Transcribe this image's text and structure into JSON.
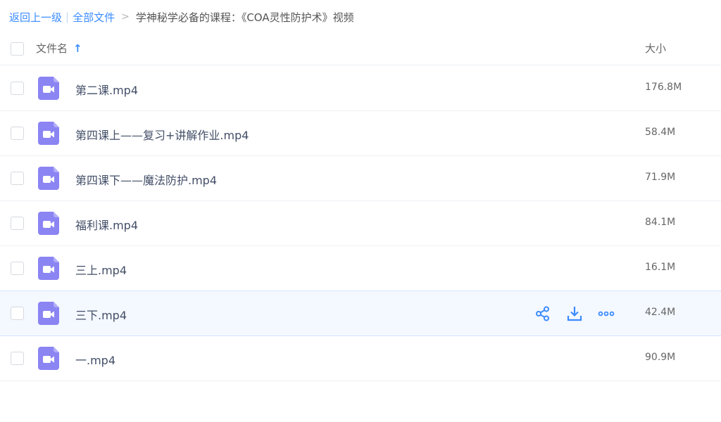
{
  "breadcrumb": {
    "back_label": "返回上一级",
    "divider": "|",
    "all_files_label": "全部文件",
    "separator": ">",
    "current_folder": "学神秘学必备的课程：《COA灵性防护术》视频"
  },
  "list_header": {
    "name_label": "文件名",
    "sort_icon": "arrow-up-icon",
    "size_label": "大小"
  },
  "files": [
    {
      "name": "第二课.mp4",
      "size": "176.8M",
      "icon": "video-file-icon"
    },
    {
      "name": "第四课上——复习+讲解作业.mp4",
      "size": "58.4M",
      "icon": "video-file-icon"
    },
    {
      "name": "第四课下——魔法防护.mp4",
      "size": "71.9M",
      "icon": "video-file-icon"
    },
    {
      "name": "福利课.mp4",
      "size": "84.1M",
      "icon": "video-file-icon"
    },
    {
      "name": "三上.mp4",
      "size": "16.1M",
      "icon": "video-file-icon"
    },
    {
      "name": "三下.mp4",
      "size": "42.4M",
      "icon": "video-file-icon",
      "hovered": true
    },
    {
      "name": "一.mp4",
      "size": "90.9M",
      "icon": "video-file-icon"
    }
  ],
  "row_actions": [
    "share-icon",
    "download-icon",
    "more-icon"
  ],
  "colors": {
    "accent": "#3b8cff",
    "video_icon": "#8b84f3",
    "hover_row": "#f4f8ff"
  }
}
